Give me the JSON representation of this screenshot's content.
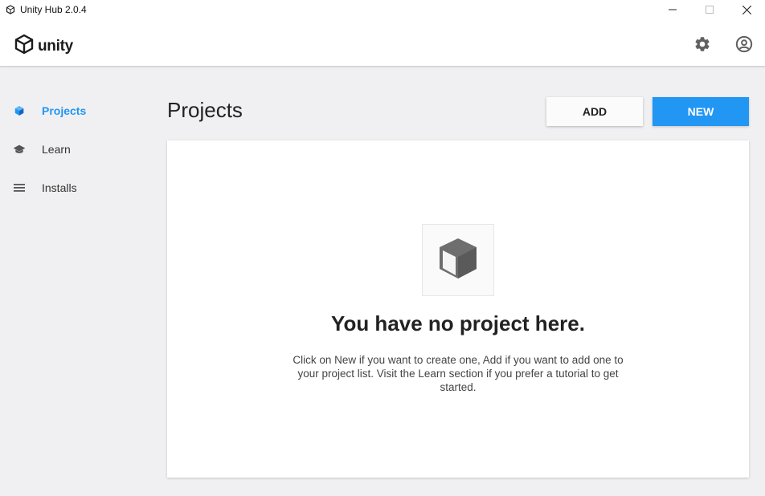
{
  "window": {
    "title": "Unity Hub 2.0.4",
    "icon": "unity-app-icon",
    "controls": [
      "minimize-icon",
      "maximize-icon",
      "close-icon"
    ]
  },
  "header": {
    "logo_text": "unity",
    "logo_icon": "unity-logo-icon",
    "settings_icon": "gear-icon",
    "account_icon": "account-circle-icon"
  },
  "sidebar": {
    "items": [
      {
        "label": "Projects",
        "icon": "cube-icon",
        "active": true
      },
      {
        "label": "Learn",
        "icon": "graduation-cap-icon",
        "active": false
      },
      {
        "label": "Installs",
        "icon": "list-icon",
        "active": false
      }
    ]
  },
  "main": {
    "title": "Projects",
    "add_label": "ADD",
    "new_label": "NEW",
    "empty": {
      "icon": "cube-icon",
      "title": "You have no project here.",
      "description": "Click on New if you want to create one, Add if you want to add one to your project list. Visit the Learn section if you prefer a tutorial to get started."
    }
  },
  "colors": {
    "accent": "#2196f3",
    "background": "#f0f0f2",
    "panel": "#ffffff"
  }
}
